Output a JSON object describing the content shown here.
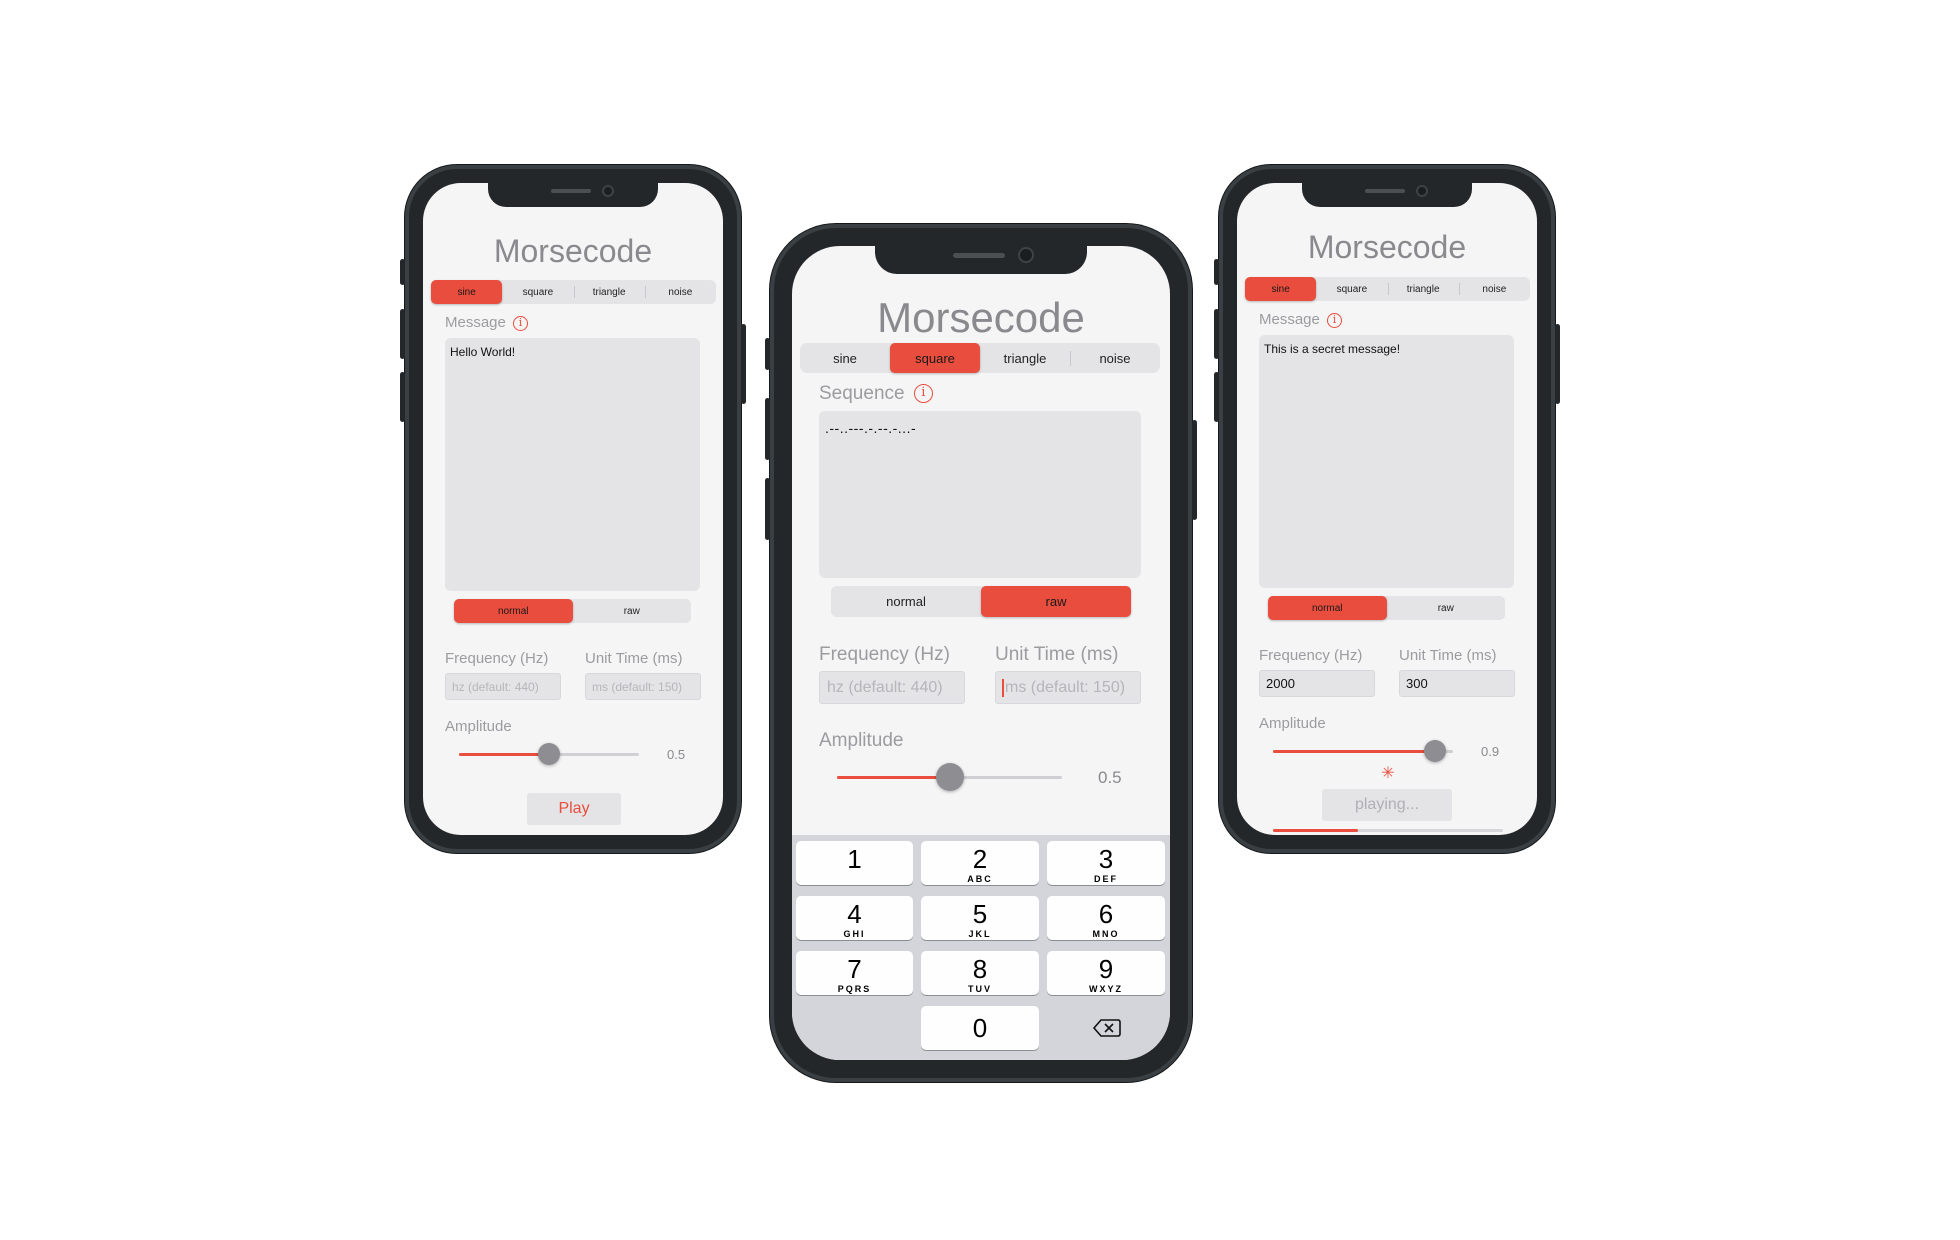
{
  "app_title": "Morsecode",
  "waveforms": [
    "sine",
    "square",
    "triangle",
    "noise"
  ],
  "modes": [
    "normal",
    "raw"
  ],
  "phones": [
    {
      "waveform_active": "sine",
      "input_label": "Message",
      "input_value": "Hello World!",
      "mode_active": "normal",
      "frequency_label": "Frequency (Hz)",
      "frequency_placeholder": "hz (default: 440)",
      "frequency_value": "",
      "unit_time_label": "Unit Time (ms)",
      "unit_time_placeholder": "ms (default: 150)",
      "unit_time_value": "",
      "amplitude_label": "Amplitude",
      "amplitude_value": "0.5",
      "amplitude_fraction": 0.5,
      "play_label": "Play"
    },
    {
      "waveform_active": "square",
      "input_label": "Sequence",
      "input_value": ".--..---.-.--.-...-",
      "mode_active": "raw",
      "frequency_label": "Frequency (Hz)",
      "frequency_placeholder": "hz (default: 440)",
      "frequency_value": "",
      "unit_time_label": "Unit Time (ms)",
      "unit_time_placeholder": "ms (default: 150)",
      "unit_time_value": "",
      "amplitude_label": "Amplitude",
      "amplitude_value": "0.5",
      "amplitude_fraction": 0.5,
      "keypad": [
        {
          "num": "1",
          "letters": ""
        },
        {
          "num": "2",
          "letters": "ABC"
        },
        {
          "num": "3",
          "letters": "DEF"
        },
        {
          "num": "4",
          "letters": "GHI"
        },
        {
          "num": "5",
          "letters": "JKL"
        },
        {
          "num": "6",
          "letters": "MNO"
        },
        {
          "num": "7",
          "letters": "PQRS"
        },
        {
          "num": "8",
          "letters": "TUV"
        },
        {
          "num": "9",
          "letters": "WXYZ"
        },
        {
          "num": "0",
          "letters": ""
        }
      ],
      "delete_icon": "backspace-icon"
    },
    {
      "waveform_active": "sine",
      "input_label": "Message",
      "input_value": "This is a secret message!",
      "mode_active": "normal",
      "frequency_label": "Frequency (Hz)",
      "frequency_placeholder": "hz (default: 440)",
      "frequency_value": "2000",
      "unit_time_label": "Unit Time (ms)",
      "unit_time_placeholder": "ms (default: 150)",
      "unit_time_value": "300",
      "amplitude_label": "Amplitude",
      "amplitude_value": "0.9",
      "amplitude_fraction": 0.9,
      "play_label": "playing...",
      "progress_fraction": 0.37
    }
  ],
  "colors": {
    "accent": "#e84d3d",
    "control_bg": "#e4e4e6",
    "screen_bg": "#f5f5f6",
    "frame": "#23272a"
  }
}
